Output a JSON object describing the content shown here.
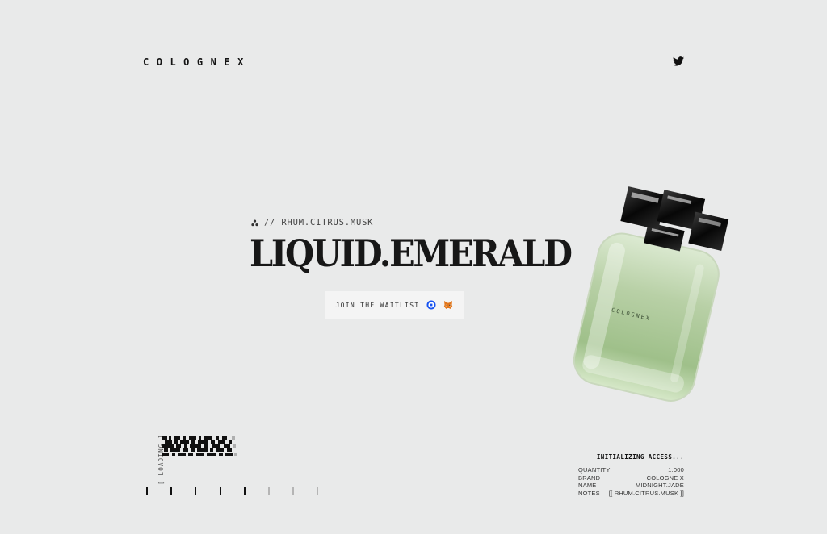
{
  "header": {
    "logo": "COLOGNEX",
    "twitter_icon": "twitter-icon"
  },
  "hero": {
    "notes_line": "// RHUM.CITRUS.MUSK_",
    "notes_icon": "three-dots-icon",
    "title": "LIQUID.EMERALD",
    "waitlist_label": "JOIN THE WAITLIST",
    "wallet_icons": [
      "coinbase-wallet-icon",
      "metamask-icon"
    ]
  },
  "loading": {
    "label": "[ LOADING ]"
  },
  "info_panel": {
    "heading": "INITIALIZING ACCESS...",
    "rows": [
      {
        "key": "QUANTITY",
        "value": "1.000"
      },
      {
        "key": "BRAND",
        "value": "COLOGNE X"
      },
      {
        "key": "NAME",
        "value": "MIDNIGHT.JADE"
      },
      {
        "key": "NOTES",
        "value": "[[ RHUM.CITRUS.MUSK ]]"
      }
    ]
  },
  "colors": {
    "background": "#e9eaea",
    "text": "#111111",
    "bottle_liquid": "#b9d3a7",
    "coinbase_blue": "#1652f0",
    "metamask_orange": "#e2761b"
  }
}
